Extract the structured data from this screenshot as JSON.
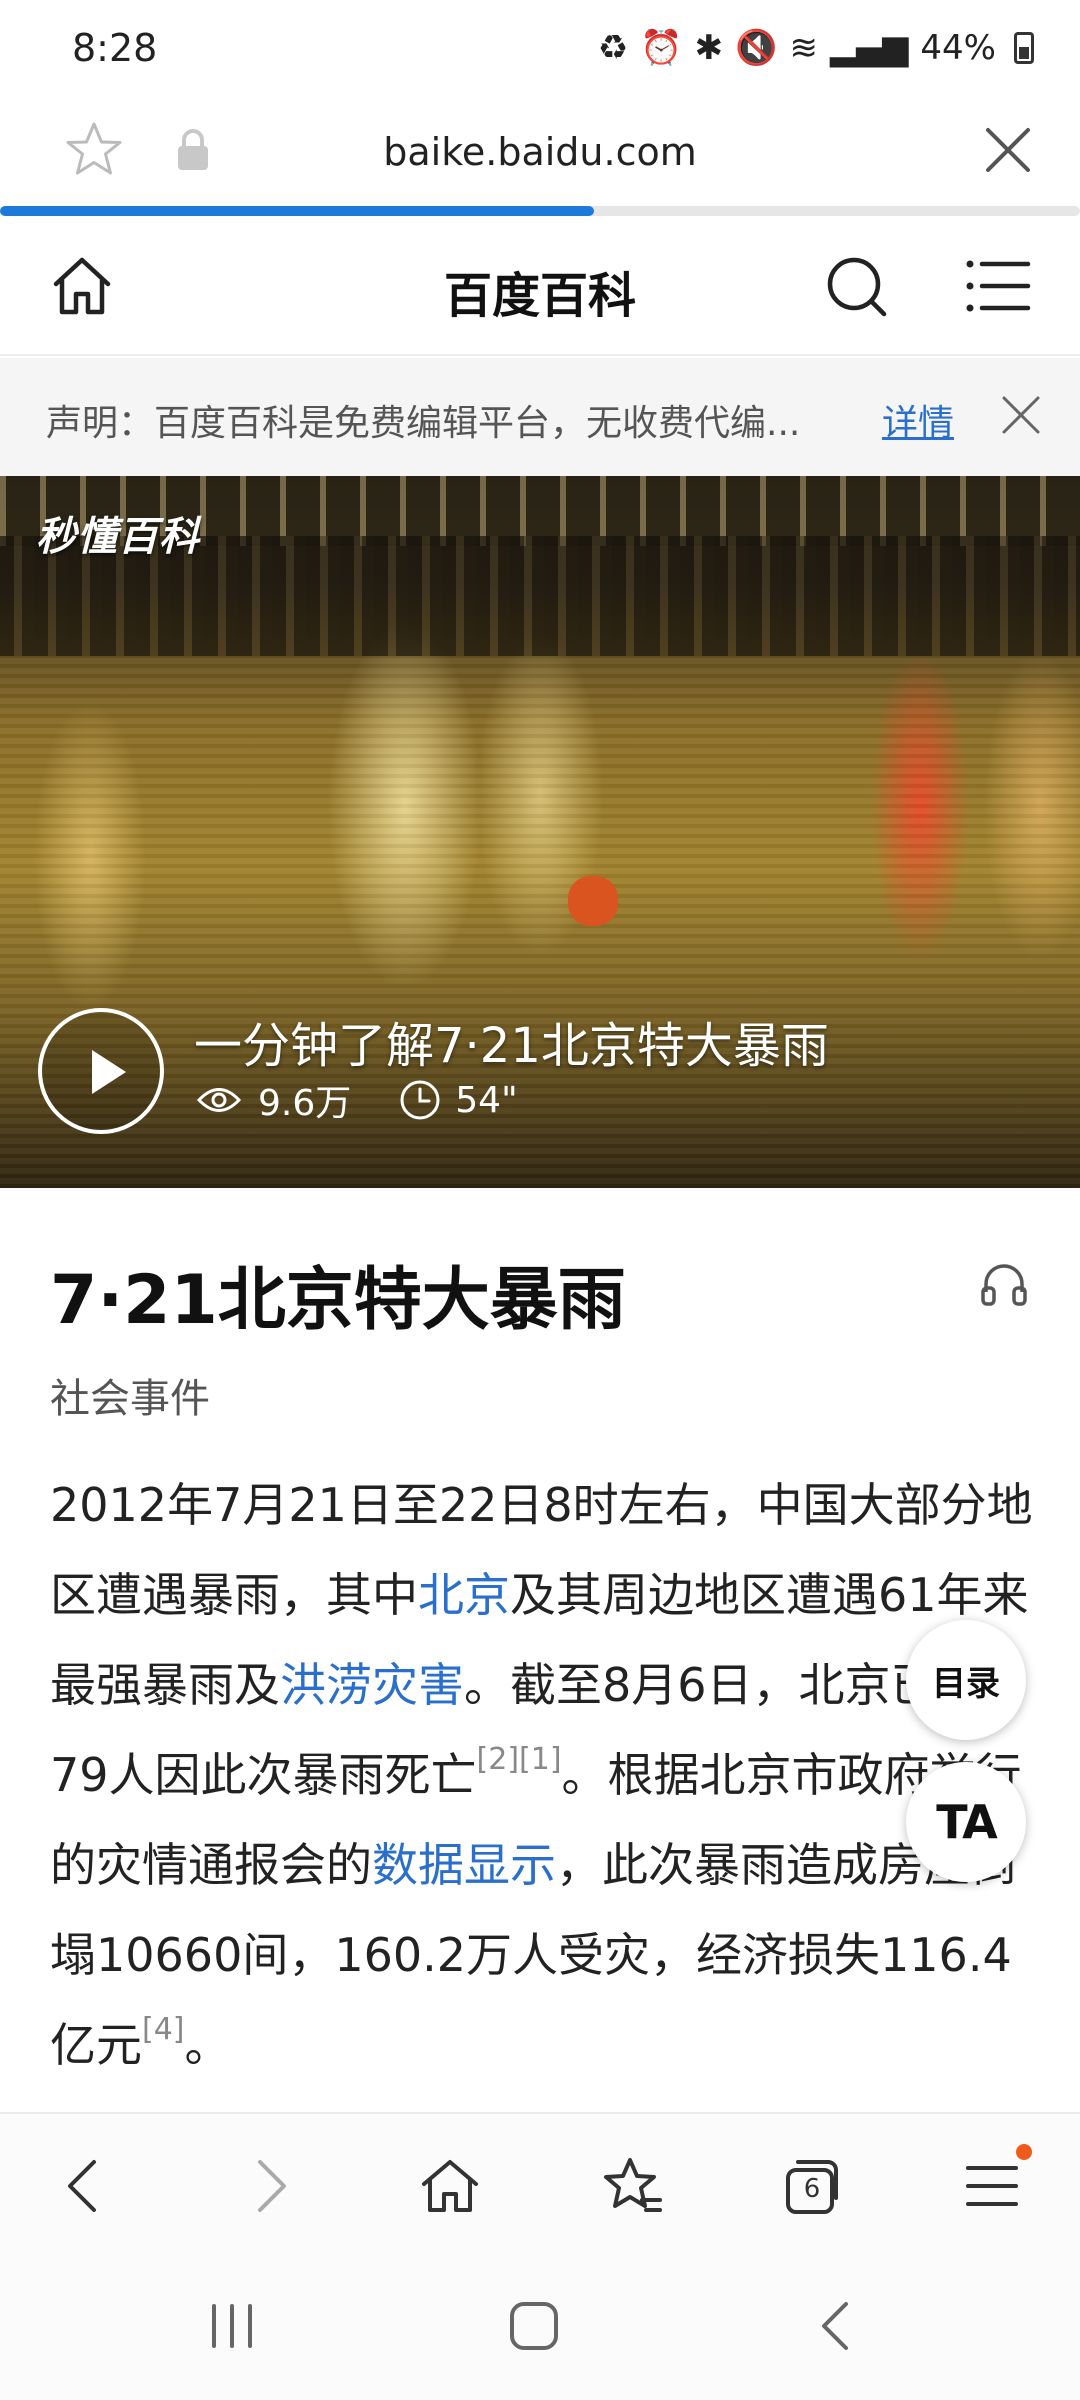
{
  "status_bar": {
    "time": "8:28",
    "battery": "44%",
    "icons": [
      "recycle-icon",
      "alarm-icon",
      "bluetooth-icon",
      "mute-icon",
      "wifi-icon",
      "signal-icon",
      "battery-icon"
    ]
  },
  "browser": {
    "url": "baike.baidu.com",
    "load_progress": 0.55,
    "accent": "#1e7ad9"
  },
  "site_nav": {
    "title": "百度百科"
  },
  "notice": {
    "text": "声明：百度百科是免费编辑平台，无收费代编...",
    "link": "详情"
  },
  "video": {
    "logo": "秒懂百科",
    "title": "一分钟了解7·21北京特大暴雨",
    "views": "9.6万",
    "duration": "54\""
  },
  "article": {
    "title": "7·21北京特大暴雨",
    "category": "社会事件",
    "p1": "2012年7月21日至22日8时左右，中国大部分地区遭遇暴雨，其中",
    "link_beijing": "北京",
    "p2": "及其周边地区遭遇61年来最强暴雨及",
    "link_flood": "洪涝灾害",
    "p3": "。截至8月6日，北京已有79人因此次暴雨死亡",
    "ref1": "[2][1]",
    "p4": "。根据北京市政府举行的灾情通报会的",
    "link_data": "数据显示",
    "p5": "，此次暴雨造成房屋倒塌10660间，160.2万人受灾，经济损失116.4亿元",
    "ref2": "[4]",
    "p6": "。"
  },
  "floating": {
    "toc": "目录",
    "ta": "TA"
  },
  "toolbar": {
    "tab_count": "6"
  }
}
